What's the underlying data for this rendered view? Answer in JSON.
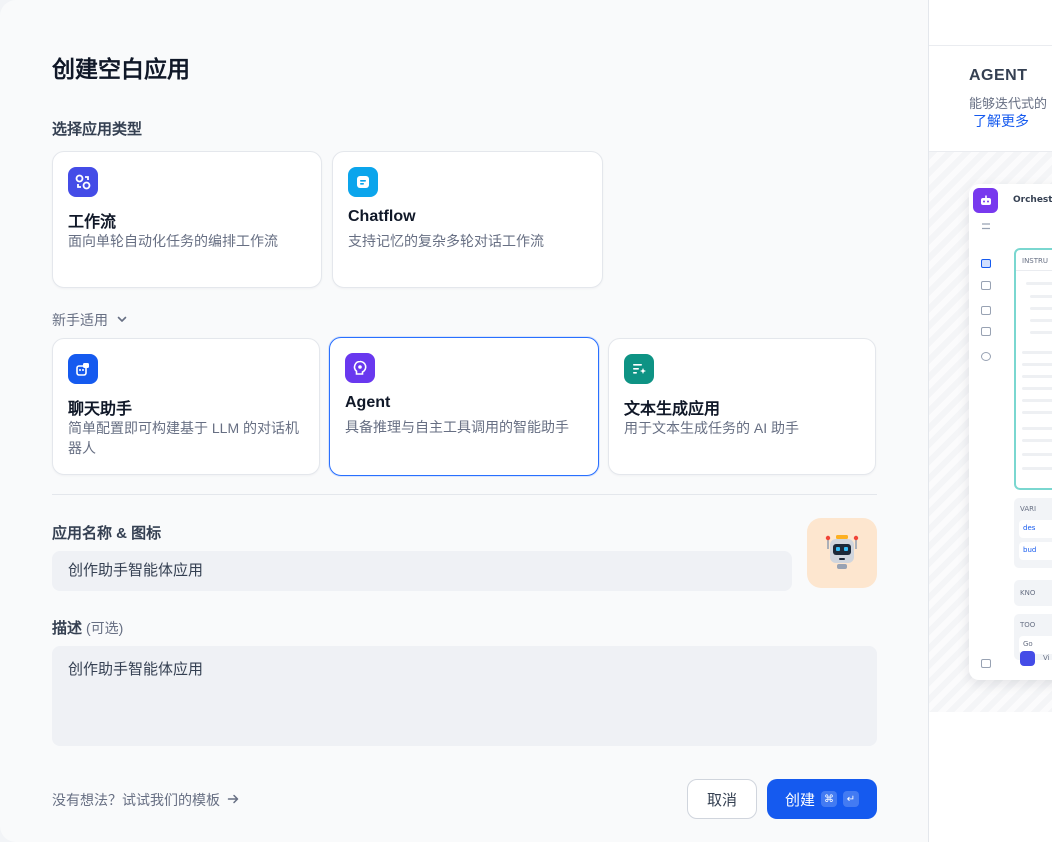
{
  "dialog": {
    "title": "创建空白应用",
    "type_section_label": "选择应用类型",
    "beginner_label": "新手适用",
    "name_icon_label": "应用名称 & 图标",
    "name_value": "创作助手智能体应用",
    "description_label": "描述",
    "description_optional": "(可选)",
    "description_value": "创作助手智能体应用",
    "template_link": "没有想法？试试我们的模板",
    "cancel_label": "取消",
    "create_label": "创建",
    "shortcut_cmd": "⌘",
    "shortcut_enter": "↵"
  },
  "app_types": [
    {
      "title": "工作流",
      "desc": "面向单轮自动化任务的编排工作流",
      "icon": "workflow-icon",
      "color": "#444ce7"
    },
    {
      "title": "Chatflow",
      "desc": "支持记忆的复杂多轮对话工作流",
      "icon": "chatflow-icon",
      "color": "#0ba5ec"
    }
  ],
  "beginner_types": [
    {
      "title": "聊天助手",
      "desc": "简单配置即可构建基于 LLM 的对话机器人",
      "icon": "chatbot-icon",
      "color": "#155aef"
    },
    {
      "title": "Agent",
      "desc": "具备推理与自主工具调用的智能助手",
      "icon": "agent-icon",
      "color": "#6938ef",
      "selected": true
    },
    {
      "title": "文本生成应用",
      "desc": "用于文本生成任务的 AI 助手",
      "icon": "text-generator-icon",
      "color": "#0e9384"
    }
  ],
  "preview_panel": {
    "title": "AGENT",
    "desc": "能够迭代式的",
    "link": "了解更多",
    "mock_header": "Orchest",
    "mock_instruction": "INSTRU",
    "mock_variables": "VARI",
    "mock_var1": "des",
    "mock_var2": "bud",
    "mock_knowledge": "KNO",
    "mock_tools": "TOO",
    "mock_tool_item": "Go",
    "mock_vision": "Vi"
  },
  "colors": {
    "accent": "#155aef",
    "selected_border": "#2970ff",
    "app_icon_bg": "#fde6cf"
  }
}
